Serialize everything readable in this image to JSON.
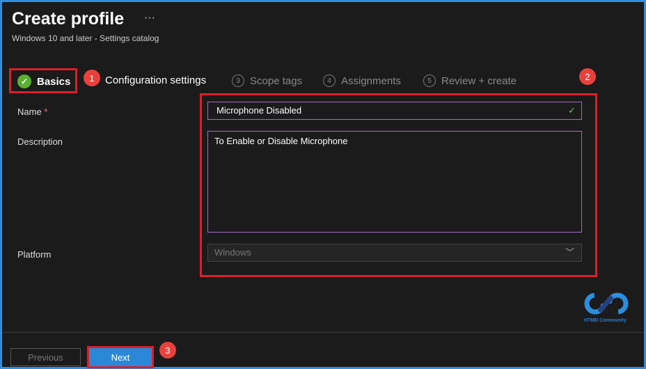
{
  "header": {
    "title": "Create profile",
    "more": "···",
    "subtitle": "Windows 10 and later - Settings catalog"
  },
  "steps": [
    {
      "label": "Basics",
      "state": "complete"
    },
    {
      "label": "Configuration settings"
    },
    {
      "num": "3",
      "label": "Scope tags"
    },
    {
      "num": "4",
      "label": "Assignments"
    },
    {
      "num": "5",
      "label": "Review + create"
    }
  ],
  "form": {
    "name_label": "Name",
    "required": "*",
    "name_value": "Microphone Disabled",
    "description_label": "Description",
    "description_value": "To Enable or Disable Microphone",
    "platform_label": "Platform",
    "platform_value": "Windows"
  },
  "annotations": {
    "a1": "1",
    "a2": "2",
    "a3": "3"
  },
  "logo": {
    "text": "HTMD Community"
  },
  "footer": {
    "previous": "Previous",
    "next": "Next"
  }
}
